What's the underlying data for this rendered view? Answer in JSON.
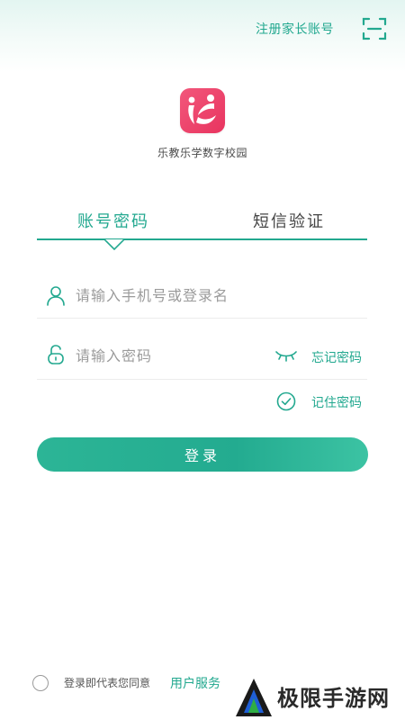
{
  "header": {
    "register_label": "注册家长账号",
    "scan_icon": "scan-icon"
  },
  "brand": {
    "app_name": "乐教乐学数字校园",
    "logo_color": "#e8345f"
  },
  "tabs": [
    {
      "label": "账号密码",
      "active": true
    },
    {
      "label": "短信验证",
      "active": false
    }
  ],
  "form": {
    "username_placeholder": "请输入手机号或登录名",
    "password_placeholder": "请输入密码",
    "forgot_label": "忘记密码",
    "remember_label": "记住密码",
    "remember_checked": true,
    "login_label": "登录"
  },
  "footer": {
    "agree_text": "登录即代表您同意",
    "service_link": "用户服务"
  },
  "watermark": {
    "text": "极限手游网"
  },
  "colors": {
    "accent": "#22a88f",
    "button_start": "#2cb596",
    "button_end": "#3cc3a3",
    "logo": "#e8345f"
  }
}
